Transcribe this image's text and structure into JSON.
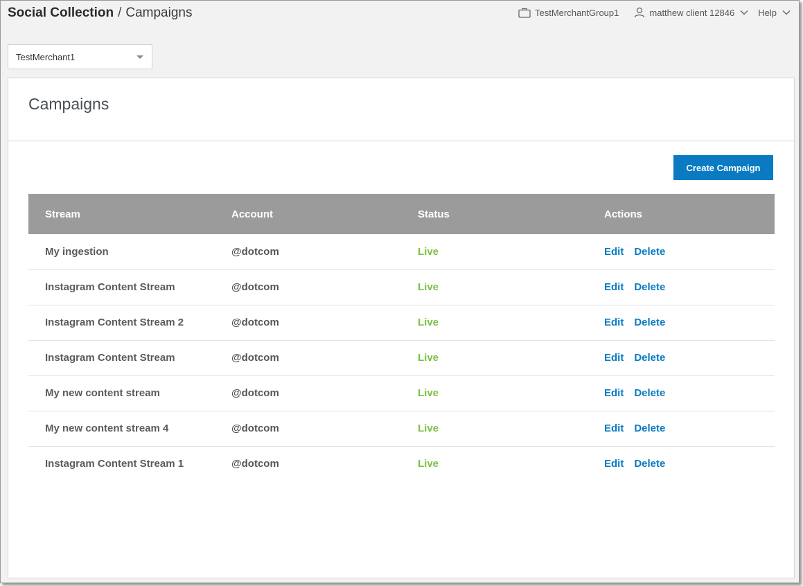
{
  "header": {
    "app_title": "Social Collection",
    "separator": "/",
    "page_title": "Campaigns",
    "merchant_group": "TestMerchantGroup1",
    "user_name": "matthew client 12846",
    "help_label": "Help",
    "icons": {
      "merchant_group": "briefcase-icon",
      "user": "user-icon",
      "user_menu": "chevron-down-icon",
      "help_menu": "chevron-down-icon"
    }
  },
  "merchant_select": {
    "selected": "TestMerchant1"
  },
  "main": {
    "title": "Campaigns",
    "create_button_label": "Create Campaign",
    "table": {
      "columns": [
        "Stream",
        "Account",
        "Status",
        "Actions"
      ],
      "rows": [
        {
          "stream": "My ingestion",
          "account": "@dotcom",
          "status": "Live",
          "edit": "Edit",
          "delete": "Delete"
        },
        {
          "stream": "Instagram Content Stream",
          "account": "@dotcom",
          "status": "Live",
          "edit": "Edit",
          "delete": "Delete"
        },
        {
          "stream": "Instagram Content Stream 2",
          "account": "@dotcom",
          "status": "Live",
          "edit": "Edit",
          "delete": "Delete"
        },
        {
          "stream": "Instagram Content Stream",
          "account": "@dotcom",
          "status": "Live",
          "edit": "Edit",
          "delete": "Delete"
        },
        {
          "stream": "My new content stream",
          "account": "@dotcom",
          "status": "Live",
          "edit": "Edit",
          "delete": "Delete"
        },
        {
          "stream": "My new content stream 4",
          "account": "@dotcom",
          "status": "Live",
          "edit": "Edit",
          "delete": "Delete"
        },
        {
          "stream": "Instagram Content Stream 1",
          "account": "@dotcom",
          "status": "Live",
          "edit": "Edit",
          "delete": "Delete"
        }
      ]
    }
  },
  "colors": {
    "accent": "#0a7bc2",
    "status_live": "#7ac142",
    "table_header": "#9b9b9b",
    "page_background": "#f2f2f2"
  }
}
